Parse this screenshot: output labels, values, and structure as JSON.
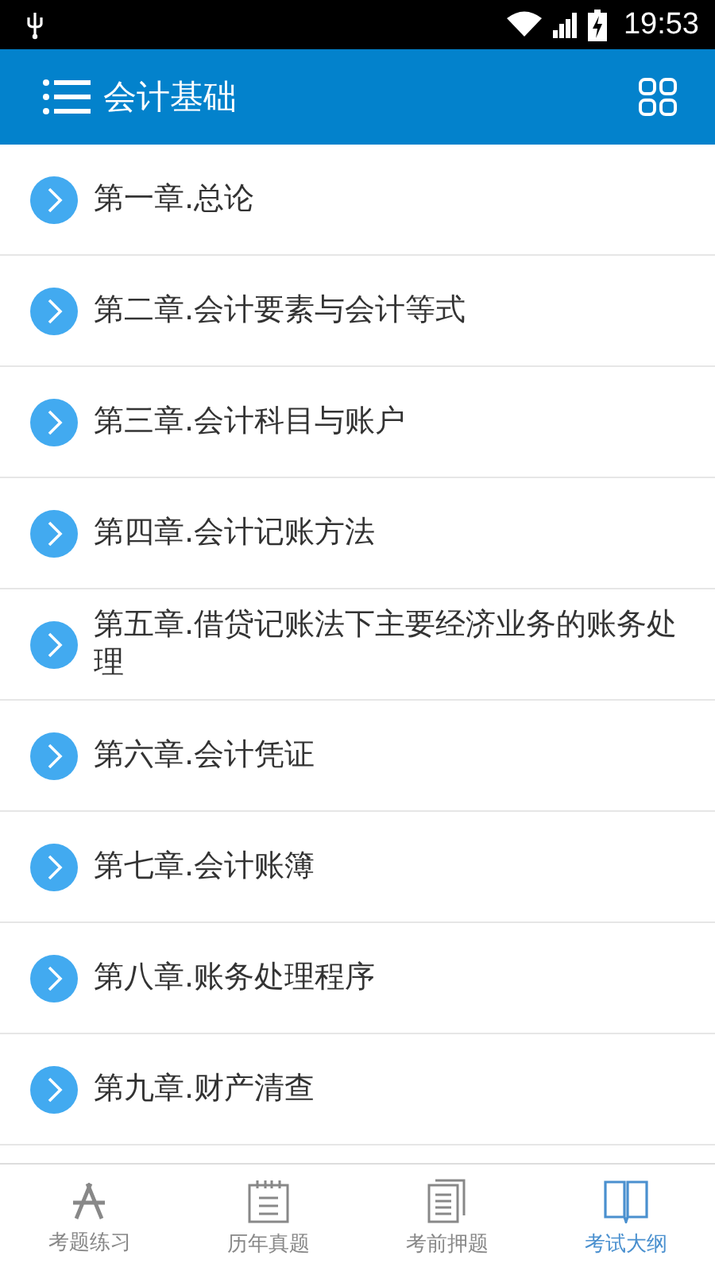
{
  "status_bar": {
    "time": "19:53"
  },
  "header": {
    "title": "会计基础"
  },
  "chapters": [
    {
      "title": "第一章.总论"
    },
    {
      "title": "第二章.会计要素与会计等式"
    },
    {
      "title": "第三章.会计科目与账户"
    },
    {
      "title": "第四章.会计记账方法"
    },
    {
      "title": "第五章.借贷记账法下主要经济业务的账务处理"
    },
    {
      "title": "第六章.会计凭证"
    },
    {
      "title": "第七章.会计账簿"
    },
    {
      "title": "第八章.账务处理程序"
    },
    {
      "title": "第九章.财产清查"
    }
  ],
  "tabs": [
    {
      "label": "考题练习",
      "kind": "practice",
      "selected": false
    },
    {
      "label": "历年真题",
      "kind": "calendar",
      "selected": false
    },
    {
      "label": "考前押题",
      "kind": "documents",
      "selected": false
    },
    {
      "label": "考试大纲",
      "kind": "book",
      "selected": true
    }
  ]
}
